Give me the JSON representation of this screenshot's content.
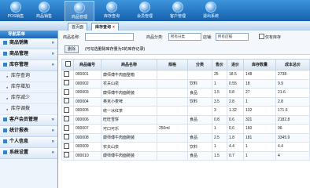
{
  "toolbar": {
    "items": [
      {
        "label": "POS销售",
        "selected": false
      },
      {
        "label": "商品销售",
        "selected": false
      },
      {
        "label": "商品管理",
        "selected": true
      },
      {
        "label": "库存查询",
        "selected": false
      },
      {
        "label": "会员管理",
        "selected": false
      },
      {
        "label": "客户管理",
        "selected": false
      },
      {
        "label": "退出系统",
        "selected": false
      }
    ]
  },
  "tabs": [
    {
      "label": "首页面"
    },
    {
      "label": "库存查询"
    }
  ],
  "tab_close": "×",
  "sidebar": {
    "title": "导航菜单",
    "items": [
      {
        "label": "商品销售",
        "type": "group"
      },
      {
        "label": "商品管理",
        "type": "group"
      },
      {
        "label": "库存管理",
        "type": "group"
      },
      {
        "label": "库存查询",
        "type": "sub"
      },
      {
        "label": "库存增加",
        "type": "sub"
      },
      {
        "label": "库存减少",
        "type": "sub"
      },
      {
        "label": "库存调拨",
        "type": "sub"
      },
      {
        "label": "客户会员管理",
        "type": "group"
      },
      {
        "label": "统计报表",
        "type": "group"
      },
      {
        "label": "个人信息",
        "type": "group"
      },
      {
        "label": "系统设置",
        "type": "group"
      }
    ]
  },
  "filter": {
    "name_label": "商品名称:",
    "category_label": "商品分类:",
    "category_value": "所有分类",
    "store_label": "店铺:",
    "store_value": "所有店铺",
    "only_stock_label": "仅有库存",
    "delete_label": "删除",
    "hint": "(可勾选删除库存量为0的库存记录)"
  },
  "table": {
    "headers": [
      "",
      "商品编号",
      "商品名称",
      "规格",
      "分类",
      "售价",
      "进价",
      "库存数量",
      "成本总价"
    ],
    "rows": [
      [
        "",
        "000001",
        "康师傅牛肉面整箱",
        "",
        "",
        "25",
        "18.5",
        "148",
        "2738"
      ],
      [
        "",
        "000002",
        "农夫山泉",
        "",
        "饮料",
        "1",
        "0.55",
        "18",
        "9.9"
      ],
      [
        "",
        "000003",
        "康师傅牛肉面碗装",
        "",
        "食品",
        "1.5",
        "0.8",
        "27",
        "21.6"
      ],
      [
        "",
        "000004",
        "奥克小麦啤",
        "",
        "饮料",
        "3.5",
        "2.8",
        "1",
        "2.8"
      ],
      [
        "",
        "000005",
        "统一冰红茶",
        "",
        "",
        "3",
        "1.32",
        "132",
        "171.6"
      ],
      [
        "",
        "000006",
        "旺旺雪饼",
        "",
        "食品",
        "0.8",
        "0.6",
        "321",
        "2182.8"
      ],
      [
        "",
        "000007",
        "可口可乐",
        "250ml",
        "",
        "1",
        "0.6",
        "160",
        "96"
      ],
      [
        "",
        "000008",
        "康师傅牛肉面碗装",
        "",
        "食品",
        "2.5",
        "1.8",
        "181",
        "3345.9"
      ],
      [
        "",
        "000009",
        "农夫山泉",
        "",
        "饮料",
        "1",
        "4.4",
        "1",
        "4.4"
      ],
      [
        "",
        "000010",
        "康师傅牛肉面碗装",
        "",
        "食品",
        "1.5",
        "0.7",
        "1",
        "4"
      ]
    ]
  },
  "colors": {
    "toolbar": "#1a64b0",
    "accent": "#3c7fc7"
  }
}
